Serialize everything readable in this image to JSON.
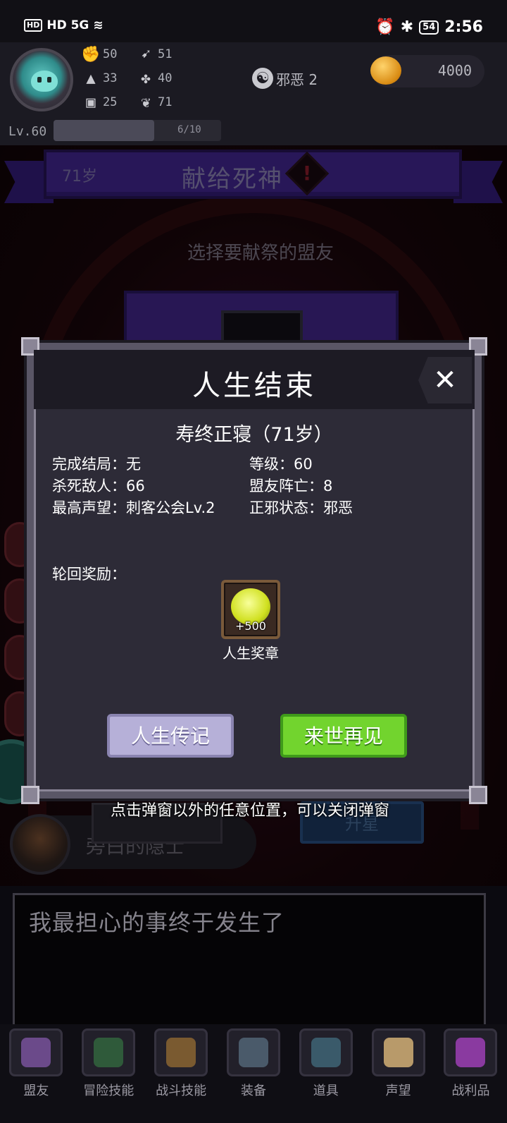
{
  "status_bar": {
    "network": "HD 5G",
    "battery": "54",
    "time": "2:56"
  },
  "hud": {
    "stats": [
      {
        "icon": "fist-icon",
        "value": "50"
      },
      {
        "icon": "boot-icon",
        "value": "51"
      },
      {
        "icon": "wizard-hat-icon",
        "value": "33"
      },
      {
        "icon": "clover-icon",
        "value": "40"
      },
      {
        "icon": "scroll-icon",
        "value": "25"
      },
      {
        "icon": "lotus-icon",
        "value": "71"
      }
    ],
    "alignment_label": "邪恶 2",
    "gold": "4000",
    "level": "Lv.60",
    "xp_text": "6/10",
    "xp_fraction": 0.6
  },
  "scene": {
    "age": "71岁",
    "banner_title": "献给死神",
    "warning_mark": "!",
    "subtitle": "选择要献祭的盟友",
    "npc_name": "旁白的隐士",
    "bg_button": "升星",
    "hint": "点击弹窗以外的任意位置，可以关闭弹窗",
    "dialog": "我最担心的事终于发生了"
  },
  "modal": {
    "title": "人生结束",
    "close": "✕",
    "death_cause": "寿终正寝（71岁）",
    "info": {
      "ending": "完成结局：无",
      "level": "等级：60",
      "kills": "杀死敌人：66",
      "ally_deaths": "盟友阵亡：8",
      "reputation": "最高声望：刺客公会Lv.2",
      "alignment": "正邪状态：邪恶"
    },
    "reward_label": "轮回奖励：",
    "reward": {
      "value": "+500",
      "name": "人生奖章"
    },
    "btn_biography": "人生传记",
    "btn_next_life": "来世再见"
  },
  "nav": [
    {
      "label": "盟友",
      "color": "#6b4a8a"
    },
    {
      "label": "冒险技能",
      "color": "#2f5a3a"
    },
    {
      "label": "战斗技能",
      "color": "#7a5a30"
    },
    {
      "label": "装备",
      "color": "#4a5a6a"
    },
    {
      "label": "道具",
      "color": "#3a5a6a"
    },
    {
      "label": "声望",
      "color": "#b89a6a"
    },
    {
      "label": "战利品",
      "color": "#8a3aa0"
    }
  ]
}
